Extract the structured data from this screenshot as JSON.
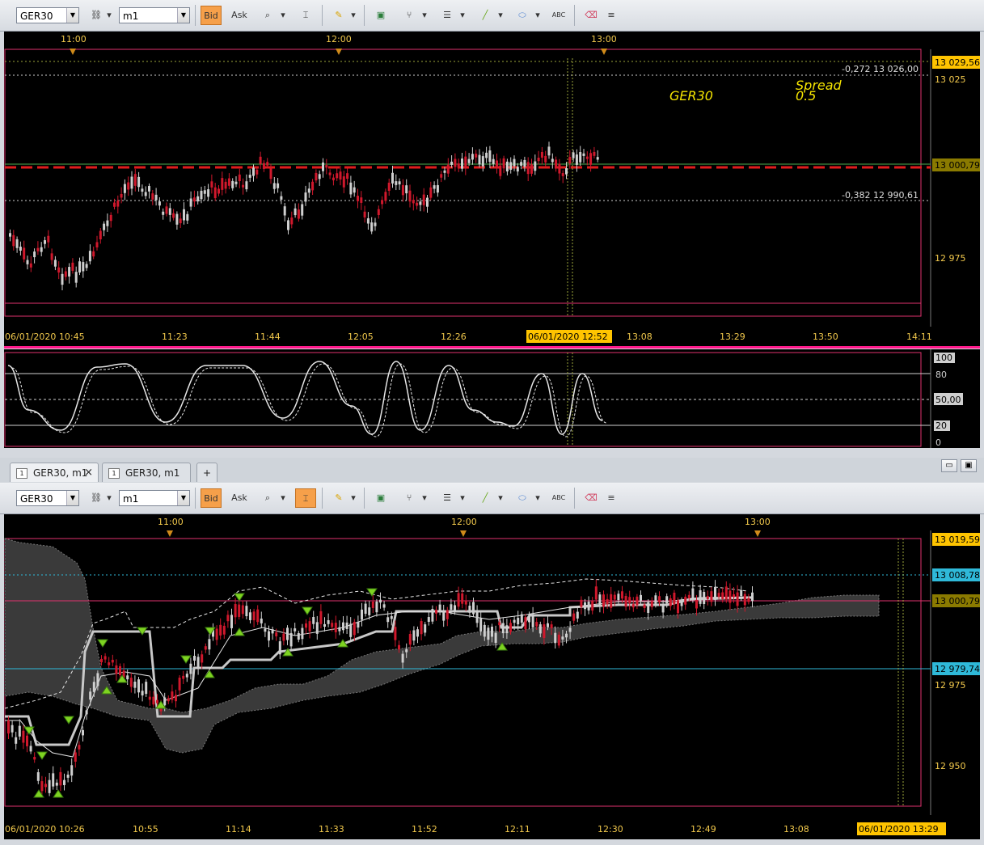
{
  "toolbar": {
    "symbol": "GER30",
    "timeframe": "m1",
    "bid_label": "Bid",
    "ask_label": "Ask",
    "abc_label": "ABC"
  },
  "top_chart": {
    "time_markers": [
      "11:00",
      "12:00",
      "13:00"
    ],
    "fib_1": "-0,272 13 026,00",
    "fib_2": "-0,382 12 990,61",
    "instrument_label": "GER30",
    "spread_title": "Spread",
    "spread_value": "0.5",
    "price_top": "13 029,56",
    "price_025": "13 025",
    "price_current": "13 000,79",
    "price_975": "12 975",
    "time_axis": [
      "06/01/2020 10:45",
      "11:23",
      "11:44",
      "12:05",
      "12:26",
      "13:08",
      "13:29",
      "13:50",
      "14:11"
    ],
    "time_highlight": "06/01/2020 12:52"
  },
  "oscillator": {
    "levels": [
      "100",
      "80",
      "50,00",
      "20",
      "0"
    ]
  },
  "tabs": [
    {
      "label": "GER30, m1",
      "close": "×"
    },
    {
      "label": "GER30, m1"
    }
  ],
  "tab_add": "+",
  "bottom_chart": {
    "time_markers": [
      "11:00",
      "12:00",
      "13:00"
    ],
    "price_top": "13 019,59",
    "price_cyan_top": "13 008,78",
    "price_current": "13 000,79",
    "price_cyan_bottom": "12 979,74",
    "price_975": "12 975",
    "price_950": "12 950",
    "time_axis": [
      "06/01/2020 10:26",
      "10:55",
      "11:14",
      "11:33",
      "11:52",
      "12:11",
      "12:30",
      "12:49",
      "13:08"
    ],
    "time_highlight": "06/01/2020 13:29"
  },
  "colors": {
    "axis_text": "#f2c94c",
    "grid_border": "#e0326e",
    "bull_candle": "#cfcfcf",
    "bear_candle": "#d0182c",
    "price_label_bg": "#ffc400",
    "cyan_label_bg": "#2fb9d9"
  }
}
